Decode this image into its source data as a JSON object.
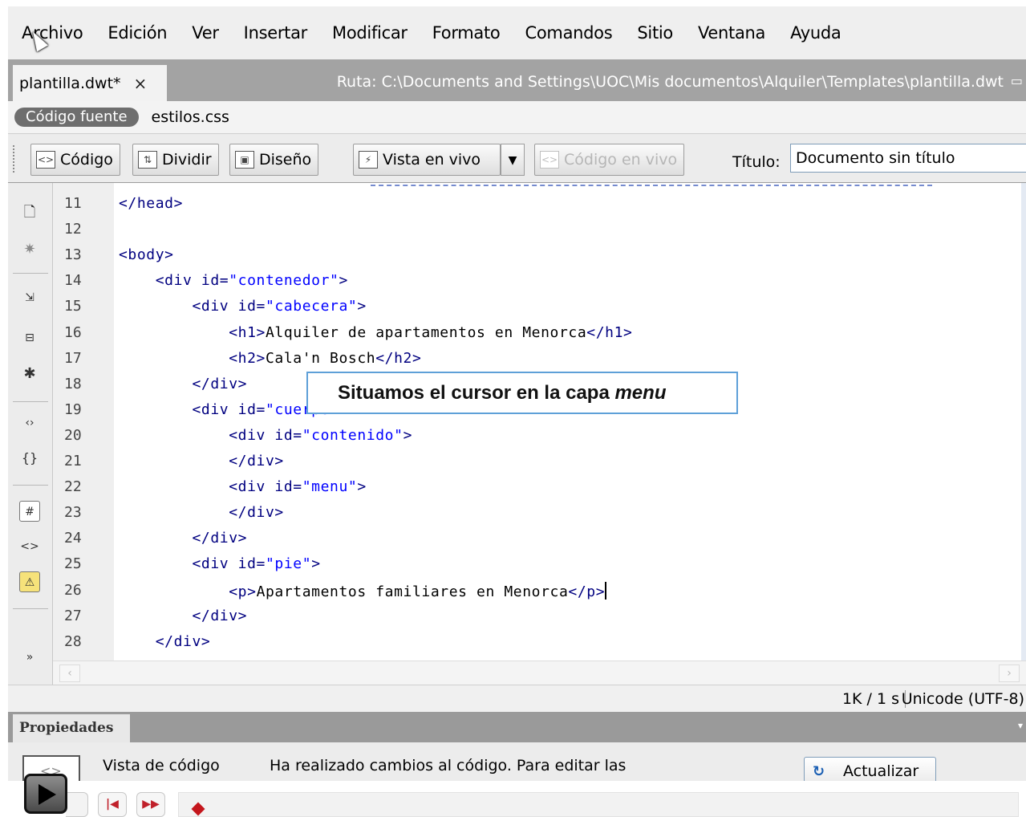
{
  "menubar": {
    "items": [
      "Archivo",
      "Edición",
      "Ver",
      "Insertar",
      "Modificar",
      "Formato",
      "Comandos",
      "Sitio",
      "Ventana",
      "Ayuda"
    ]
  },
  "doc_tab": {
    "name": "plantilla.dwt*",
    "close": "×",
    "path": "Ruta:  C:\\Documents and Settings\\UOC\\Mis documentos\\Alquiler\\Templates\\plantilla.dwt"
  },
  "related_files": {
    "source": "Código fuente",
    "file": "estilos.css"
  },
  "toolbar": {
    "code_label": "Código",
    "split_label": "Dividir",
    "design_label": "Diseño",
    "live_view_label": "Vista en vivo",
    "live_code_label": "Código en vivo",
    "title_label": "Título:",
    "title_value": "Documento sin título"
  },
  "code_lines": [
    {
      "n": "11",
      "text": "</head>"
    },
    {
      "n": "12",
      "text": ""
    },
    {
      "n": "13",
      "text": "<body>"
    },
    {
      "n": "14",
      "text": "    <div id=\"contenedor\">"
    },
    {
      "n": "15",
      "text": "        <div id=\"cabecera\">"
    },
    {
      "n": "16",
      "text": "            <h1>Alquiler de apartamentos en Menorca</h1>"
    },
    {
      "n": "17",
      "text": "            <h2>Cala'n Bosch</h2>"
    },
    {
      "n": "18",
      "text": "        </div>"
    },
    {
      "n": "19",
      "text": "        <div id=\"cuerpo\">"
    },
    {
      "n": "20",
      "text": "            <div id=\"contenido\">"
    },
    {
      "n": "21",
      "text": "            </div>"
    },
    {
      "n": "22",
      "text": "            <div id=\"menu\">"
    },
    {
      "n": "23",
      "text": "            </div>"
    },
    {
      "n": "24",
      "text": "        </div>"
    },
    {
      "n": "25",
      "text": "        <div id=\"pie\">"
    },
    {
      "n": "26",
      "text": "            <p>Apartamentos familiares en Menorca</p>"
    },
    {
      "n": "27",
      "text": "        </div>"
    },
    {
      "n": "28",
      "text": "    </div>"
    }
  ],
  "callout": {
    "text": "Situamos el cursor en la capa ",
    "emphasis": "menu"
  },
  "status": {
    "size": "1K / 1 s",
    "encoding": "Unicode (UTF-8)"
  },
  "properties": {
    "tab": "Propiedades",
    "label": "Vista de código",
    "message": "Ha realizado cambios al código. Para editar las",
    "refresh": "Actualizar"
  },
  "coding_toolbar": {
    "icons": [
      "open-documents-icon",
      "show-code-navigator-icon",
      "collapse-full-tag-icon",
      "collapse-selection-icon",
      "expand-all-icon",
      "select-parent-tag-icon",
      "balance-braces-icon",
      "line-numbers-icon",
      "highlight-invalid-code-icon",
      "syntax-error-alerts-icon",
      "more-icon"
    ]
  },
  "colors": {
    "tag": "#000080",
    "attribute_value": "#0000ff",
    "callout_border": "#5ea0d8",
    "player_accent": "#c4161c"
  }
}
